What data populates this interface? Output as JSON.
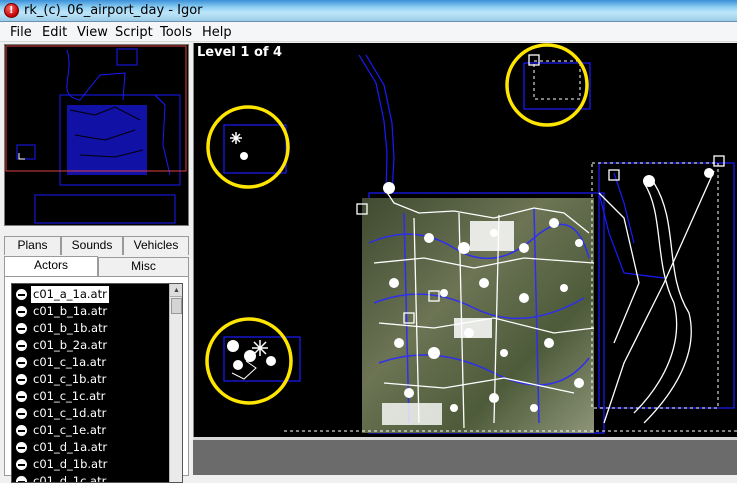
{
  "window": {
    "title": "rk_(c)_06_airport_day - Igor",
    "app_icon_glyph": "!"
  },
  "menubar": {
    "items": [
      {
        "label": "File"
      },
      {
        "label": "Edit"
      },
      {
        "label": "View"
      },
      {
        "label": "Script"
      },
      {
        "label": "Tools"
      },
      {
        "label": "Help"
      }
    ]
  },
  "tabs": {
    "row1": [
      {
        "label": "Plans"
      },
      {
        "label": "Sounds"
      },
      {
        "label": "Vehicles"
      }
    ],
    "row2": [
      {
        "label": "Actors",
        "active": true
      },
      {
        "label": "Misc"
      }
    ]
  },
  "actors": {
    "selected": "c01_a_1a.atr",
    "items": [
      "c01_a_1a.atr",
      "c01_b_1a.atr",
      "c01_b_1b.atr",
      "c01_b_2a.atr",
      "c01_c_1a.atr",
      "c01_c_1b.atr",
      "c01_c_1c.atr",
      "c01_c_1d.atr",
      "c01_c_1e.atr",
      "c01_d_1a.atr",
      "c01_d_1b.atr",
      "c01_d_1c.atr"
    ]
  },
  "viewport": {
    "level_label": "Level 1 of 4",
    "highlight_color": "#ffe600",
    "outline_color": "#1a1aff"
  }
}
